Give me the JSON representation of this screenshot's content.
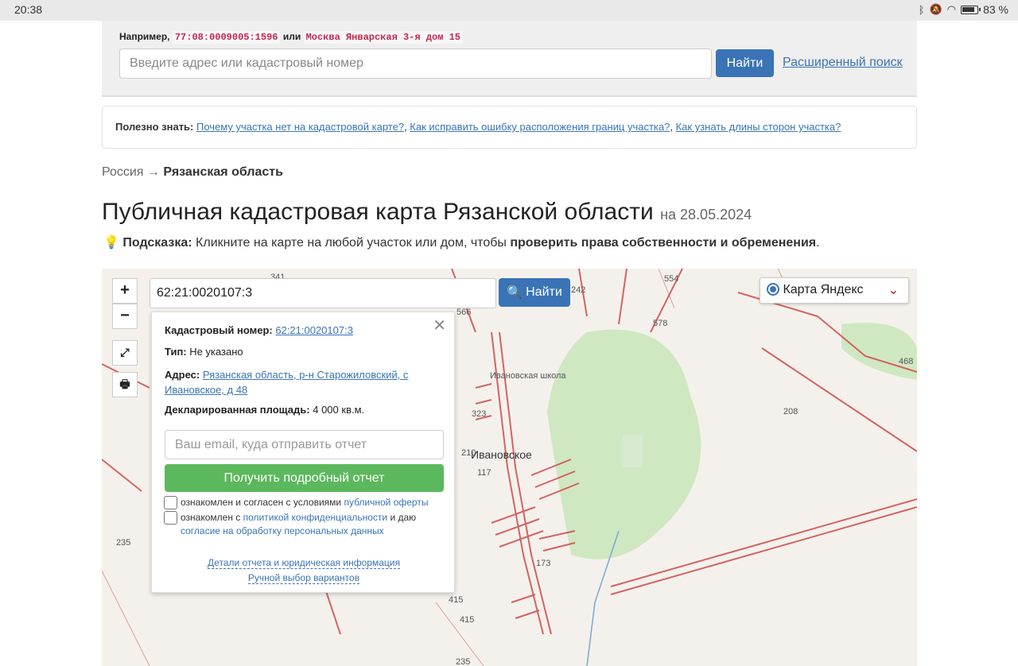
{
  "status_bar": {
    "time": "20:38",
    "battery": "83 %"
  },
  "search": {
    "example_label": "Например,",
    "example_code": "77:08:0009005:1596",
    "example_or": "или",
    "example_address": "Москва Январская 3-я дом 15",
    "placeholder": "Введите адрес или кадастровый номер",
    "button": "Найти",
    "advanced": "Расширенный поиск"
  },
  "useful": {
    "label": "Полезно знать:",
    "links": [
      "Почему участка нет на кадастровой карте?",
      "Как исправить ошибку расположения границ участка?",
      "Как узнать длины сторон участка?"
    ]
  },
  "breadcrumb": {
    "root": "Россия",
    "arrow": "→",
    "current": "Рязанская область"
  },
  "title": {
    "main": "Публичная кадастровая карта Рязанской области",
    "date": "на 28.05.2024"
  },
  "hint": {
    "label": "Подсказка:",
    "text": "Кликните на карте на любой участок или дом, чтобы",
    "bold": "проверить права собственности и обременения",
    "end": "."
  },
  "map": {
    "search_value": "62:21:0020107:3",
    "find_button": "Найти",
    "layer": "Карта Яндекс",
    "zoom_in": "+",
    "zoom_out": "−",
    "labels": {
      "village": "Ивановское",
      "school": "Ивановская школа",
      "n554": "554",
      "n341": "341",
      "n566": "566",
      "n578": "578",
      "n242": "242",
      "n468": "468",
      "n208": "208",
      "n323": "323",
      "n210": "210",
      "n117": "117",
      "n173": "173",
      "n235a": "235",
      "n415a": "415",
      "n415b": "415",
      "n235b": "235"
    }
  },
  "popup": {
    "cad_label": "Кадастровый номер:",
    "cad_value": "62:21:0020107:3",
    "type_label": "Тип:",
    "type_value": "Не указано",
    "addr_label": "Адрес:",
    "addr_line1": "Рязанская область, р-н Старожиловский, с",
    "addr_line2": "Ивановское, д 48",
    "area_label": "Декларированная площадь:",
    "area_value": "4 000 кв.м.",
    "email_placeholder": "Ваш email, куда отправить отчет",
    "report_button": "Получить подробный отчет",
    "cb1_text": "ознакомлен и согласен с условиями",
    "cb1_link": "публичной оферты",
    "cb2_text": "ознакомлен с",
    "cb2_link": "политикой конфиденциальности",
    "cb2_and": "и даю",
    "cb2_link2": "согласие на обработку персональных данных",
    "details_link": "Детали отчета и юридическая информация",
    "manual_link": "Ручной выбор вариантов"
  }
}
